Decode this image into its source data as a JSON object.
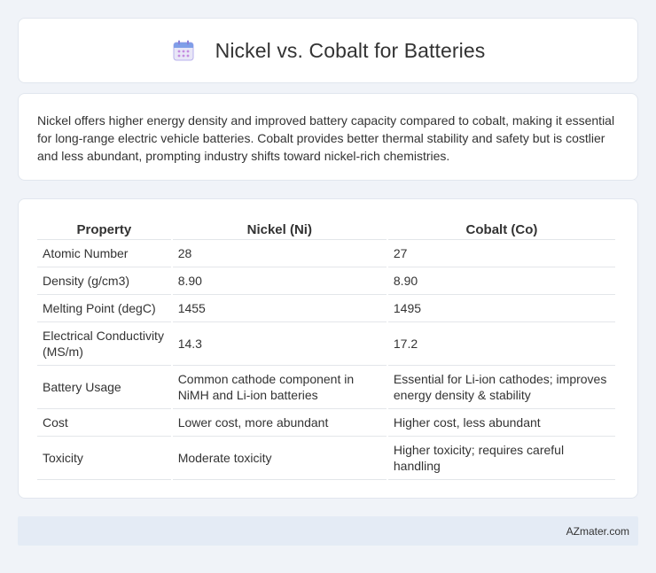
{
  "header": {
    "title": "Nickel vs. Cobalt for Batteries",
    "icon": "calendar-icon"
  },
  "intro": {
    "text": "Nickel offers higher energy density and improved battery capacity compared to cobalt, making it essential for long-range electric vehicle batteries. Cobalt provides better thermal stability and safety but is costlier and less abundant, prompting industry shifts toward nickel-rich chemistries."
  },
  "table": {
    "headers": [
      "Property",
      "Nickel (Ni)",
      "Cobalt (Co)"
    ],
    "rows": [
      [
        "Atomic Number",
        "28",
        "27"
      ],
      [
        "Density (g/cm3)",
        "8.90",
        "8.90"
      ],
      [
        "Melting Point (degC)",
        "1455",
        "1495"
      ],
      [
        "Electrical Conductivity (MS/m)",
        "14.3",
        "17.2"
      ],
      [
        "Battery Usage",
        "Common cathode component in NiMH and Li-ion batteries",
        "Essential for Li-ion cathodes; improves energy density & stability"
      ],
      [
        "Cost",
        "Lower cost, more abundant",
        "Higher cost, less abundant"
      ],
      [
        "Toxicity",
        "Moderate toxicity",
        "Higher toxicity; requires careful handling"
      ]
    ]
  },
  "footer": {
    "brand": "AZmater.com"
  },
  "colors": {
    "background": "#f0f3f8",
    "card": "#ffffff",
    "footer": "#e4ebf5",
    "icon_accent": "#8b7fd8"
  }
}
